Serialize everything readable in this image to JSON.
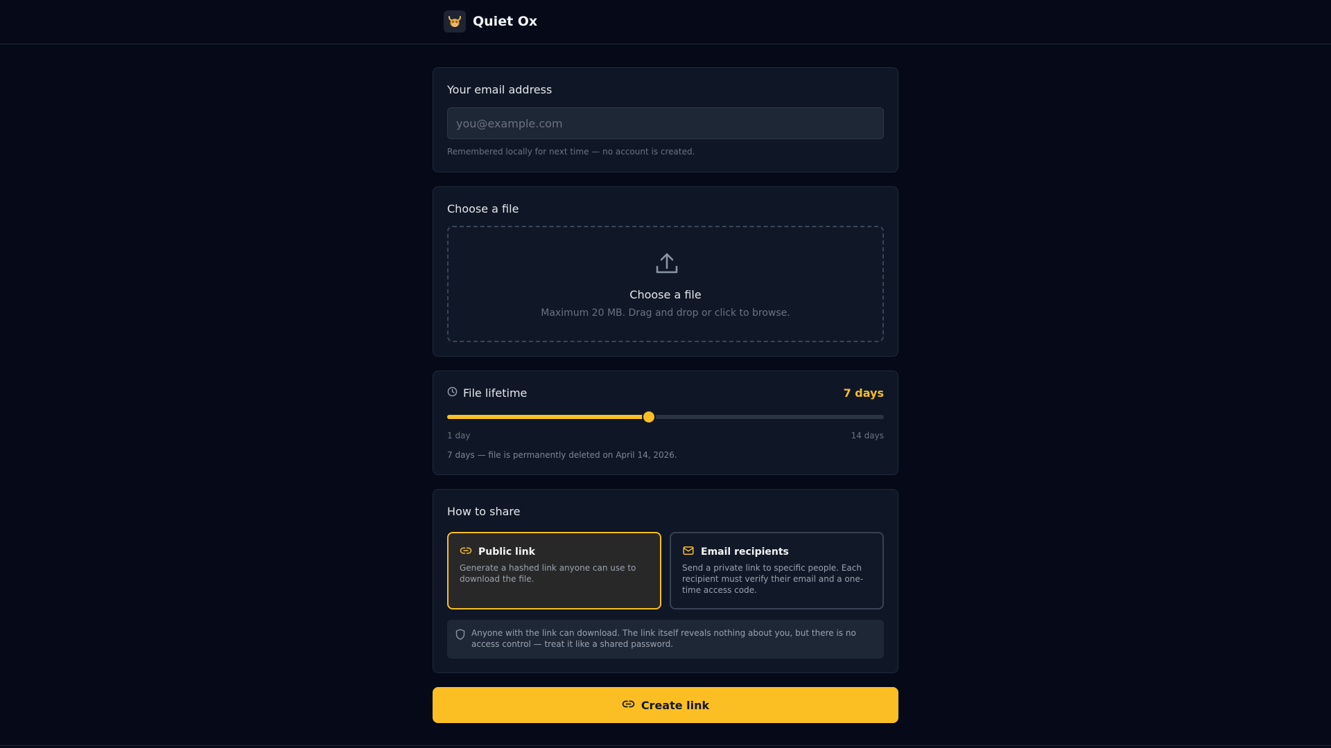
{
  "header": {
    "brand_name": "Quiet Ox",
    "logo_icon": "ox-face-icon"
  },
  "email_section": {
    "title": "Your email address",
    "input_value": "",
    "placeholder": "you@example.com",
    "help": "Remembered locally for next time — no account is created."
  },
  "file_section": {
    "title": "Choose a file",
    "dropzone_title": "Choose a file",
    "dropzone_subtitle": "Maximum 20 MB. Drag and drop or click to browse.",
    "icon": "upload-icon"
  },
  "lifetime_section": {
    "title": "File lifetime",
    "icon": "clock-icon",
    "value_label": "7 days",
    "value": 7,
    "min": 1,
    "max": 14,
    "min_label": "1 day",
    "max_label": "14 days",
    "note": "7 days — file is permanently deleted on April 14, 2026."
  },
  "share_section": {
    "title": "How to share",
    "selected": "public",
    "options": [
      {
        "id": "public",
        "icon": "link-icon",
        "title": "Public link",
        "description": "Generate a hashed link anyone can use to download the file."
      },
      {
        "id": "email",
        "icon": "mail-icon",
        "title": "Email recipients",
        "description": "Send a private link to specific people. Each recipient must verify their email and a one-time access code."
      }
    ],
    "note_icon": "shield-icon",
    "note": "Anyone with the link can download. The link itself reveals nothing about you, but there is no access control — treat it like a shared password."
  },
  "create_button": {
    "label": "Create link",
    "icon": "link-icon"
  },
  "colors": {
    "background": "#050918",
    "card": "#0f1726",
    "accent": "#fbbf24",
    "muted_text": "#6b7280"
  }
}
